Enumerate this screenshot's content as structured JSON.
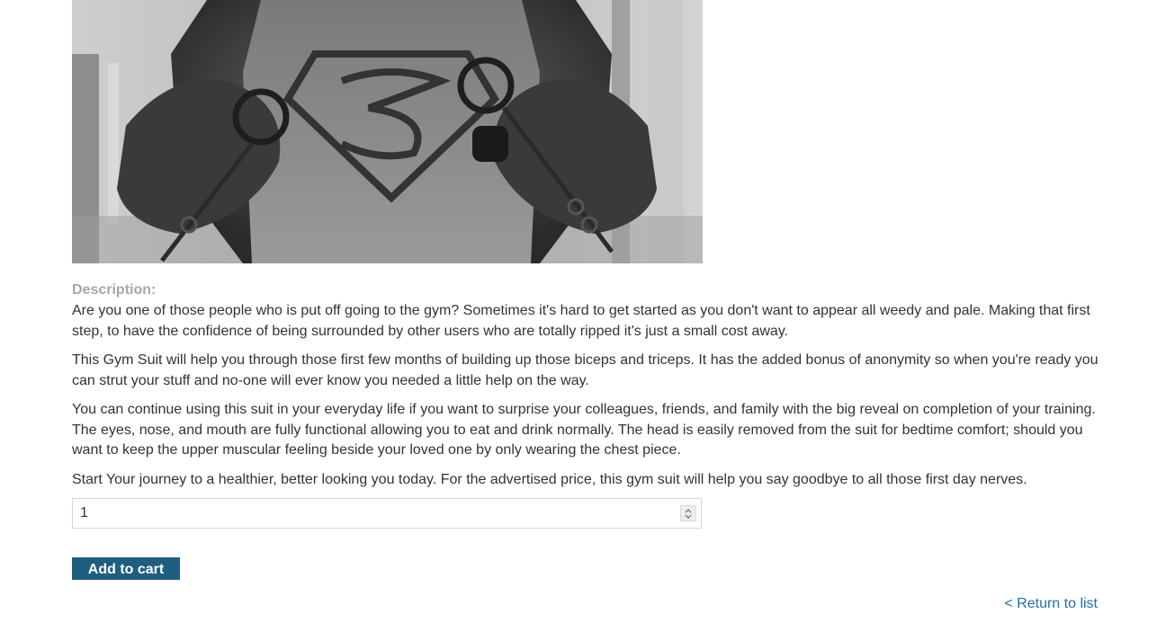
{
  "product": {
    "image_alt": "Gym Suit"
  },
  "description": {
    "label": "Description:",
    "paragraphs": [
      "Are you one of those people who is put off going to the gym? Sometimes it's hard to get started as you don't want to appear all weedy and pale. Making that first step, to have the confidence of being surrounded by other users who are totally ripped it's just a small cost away.",
      "This Gym Suit will help you through those first few months of building up those biceps and triceps. It has the added bonus of anonymity so when you're ready you can strut your stuff and no-one will ever know you needed a little help on the way.",
      "You can continue using this suit in your everyday life if you want to surprise your colleagues, friends, and family with the big reveal on completion of your training. The eyes, nose, and mouth are fully functional allowing you to eat and drink normally. The head is easily removed from the suit for bedtime comfort; should you want to keep the upper muscular feeling beside your loved one by only wearing the chest piece.",
      "Start Your journey to a healthier, better looking you today. For the advertised price, this gym suit will help you say goodbye to all those first day nerves."
    ]
  },
  "cart": {
    "quantity": "1",
    "add_label": "Add to cart"
  },
  "nav": {
    "return_label": "< Return to list"
  },
  "colors": {
    "button_bg": "#1f5e7e",
    "link": "#1f6fa8",
    "label": "#a7a7a7"
  }
}
